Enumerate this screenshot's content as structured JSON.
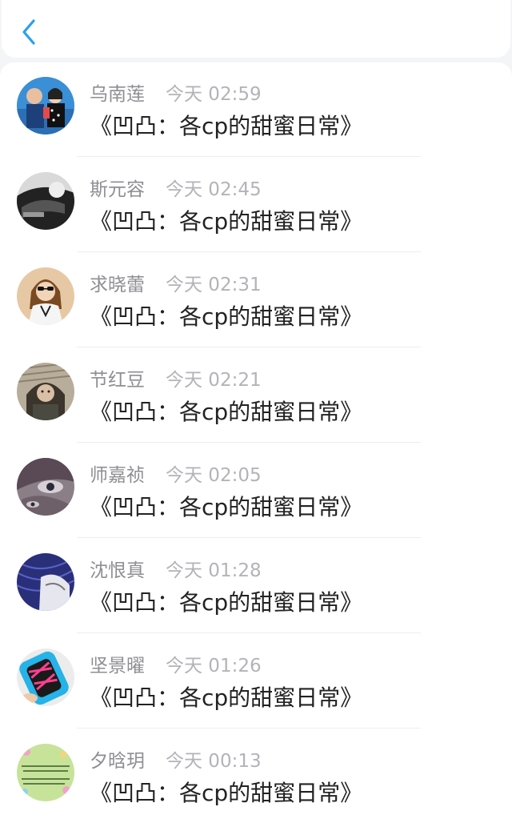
{
  "header": {
    "back_icon": "chevron-left-icon",
    "accent": "#2aa0f0"
  },
  "messages": [
    {
      "name": "乌南莲",
      "time": "今天 02:59",
      "text": "《凹凸：各cp的甜蜜日常》"
    },
    {
      "name": "斯元容",
      "time": "今天 02:45",
      "text": "《凹凸：各cp的甜蜜日常》"
    },
    {
      "name": "求晓蕾",
      "time": "今天 02:31",
      "text": "《凹凸：各cp的甜蜜日常》"
    },
    {
      "name": "节红豆",
      "time": "今天 02:21",
      "text": "《凹凸：各cp的甜蜜日常》"
    },
    {
      "name": "师嘉祯",
      "time": "今天 02:05",
      "text": "《凹凸：各cp的甜蜜日常》"
    },
    {
      "name": "沈恨真",
      "time": "今天 01:28",
      "text": "《凹凸：各cp的甜蜜日常》"
    },
    {
      "name": "坚景曜",
      "time": "今天 01:26",
      "text": "《凹凸：各cp的甜蜜日常》"
    },
    {
      "name": "夕晗玥",
      "time": "今天 00:13",
      "text": "《凹凸：各cp的甜蜜日常》"
    }
  ]
}
